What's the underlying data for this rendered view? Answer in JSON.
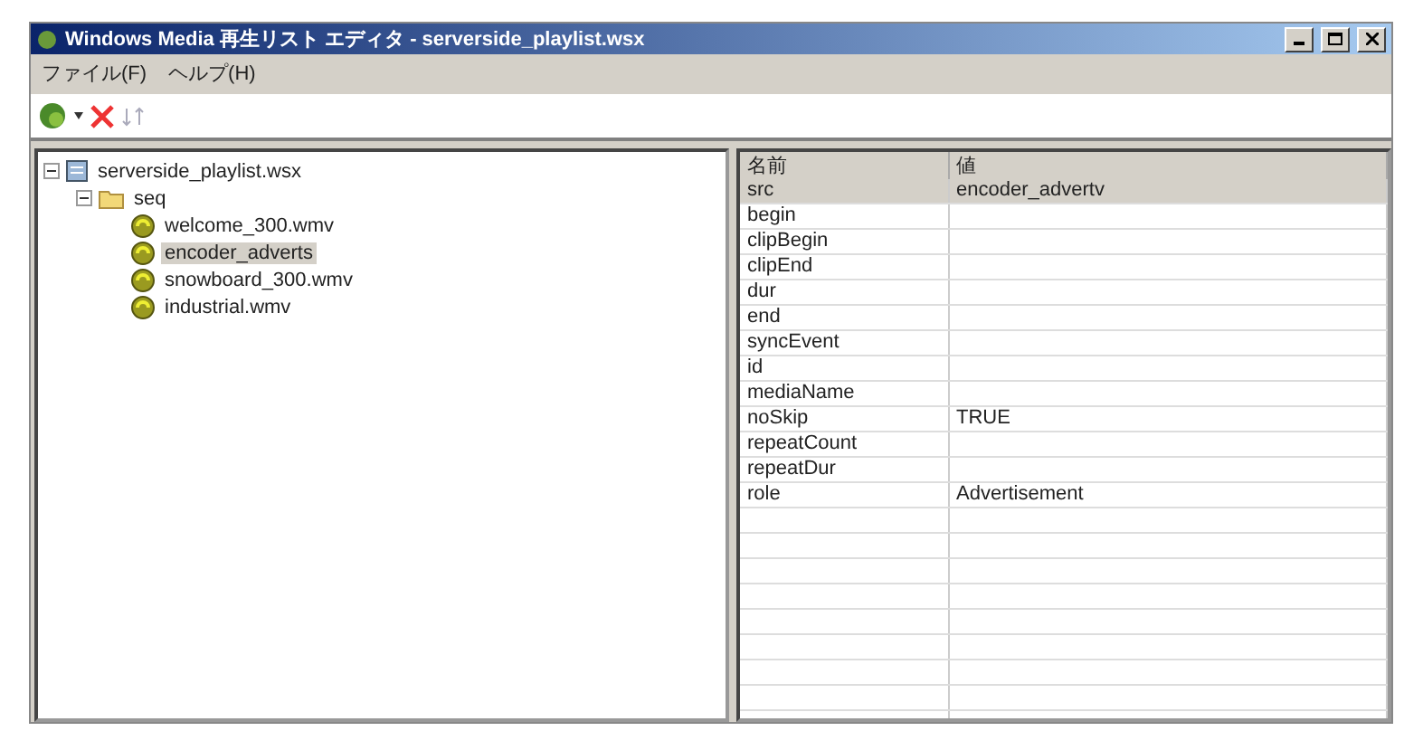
{
  "window": {
    "title": "Windows Media 再生リスト エディタ - serverside_playlist.wsx"
  },
  "menu": [
    "ファイル(F)",
    "ヘルプ(H)"
  ],
  "tree": [
    {
      "label": "serverside_playlist.wsx",
      "kind": "playlist",
      "expanded": true,
      "selected": false,
      "children": [
        {
          "label": "seq",
          "kind": "folder",
          "expanded": true,
          "selected": false,
          "children": [
            {
              "label": "welcome_300.wmv",
              "kind": "media",
              "selected": false
            },
            {
              "label": "encoder_adverts",
              "kind": "media",
              "selected": true
            },
            {
              "label": "snowboard_300.wmv",
              "kind": "media",
              "selected": false
            },
            {
              "label": "industrial.wmv",
              "kind": "media",
              "selected": false
            }
          ]
        }
      ]
    }
  ],
  "properties": {
    "columns": [
      "名前",
      "値"
    ],
    "rows": [
      {
        "name": "src",
        "value": "encoder_advertv",
        "selected": true
      },
      {
        "name": "begin",
        "selected": false
      },
      {
        "name": "clipBegin",
        "selected": false
      },
      {
        "name": "clipEnd",
        "selected": false
      },
      {
        "name": "dur",
        "selected": false
      },
      {
        "name": "end",
        "selected": false
      },
      {
        "name": "syncEvent",
        "selected": false
      },
      {
        "name": "id",
        "selected": false
      },
      {
        "name": "mediaName",
        "selected": false
      },
      {
        "name": "noSkip",
        "value": "TRUE",
        "selected": false
      },
      {
        "name": "repeatCount",
        "selected": false
      },
      {
        "name": "repeatDur",
        "selected": false
      },
      {
        "name": "role",
        "value": "Advertisement",
        "selected": false
      }
    ]
  }
}
